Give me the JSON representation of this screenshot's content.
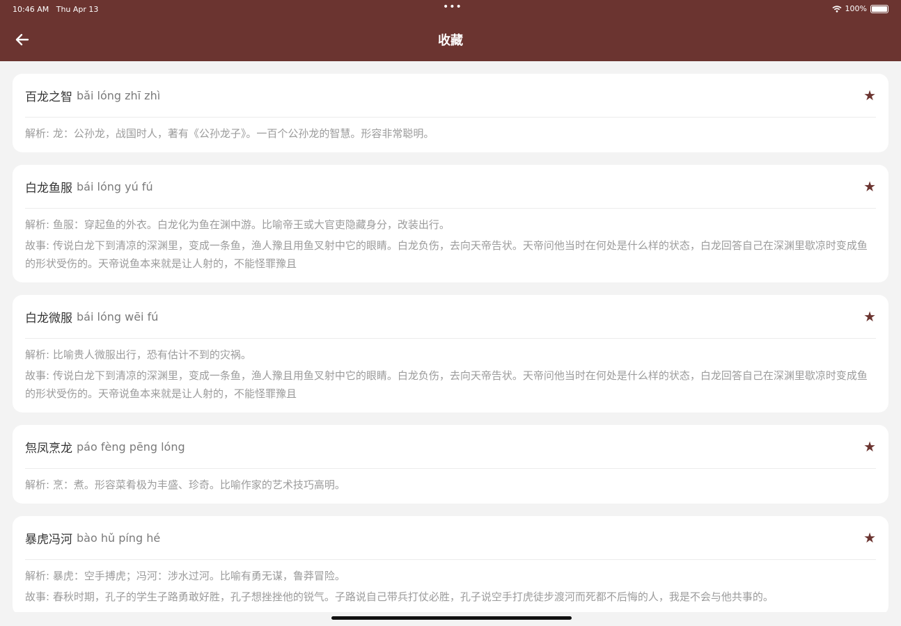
{
  "status": {
    "time": "10:46 AM",
    "date": "Thu Apr 13",
    "battery": "100%"
  },
  "header": {
    "title": "收藏"
  },
  "items": [
    {
      "word": "百龙之智",
      "pinyin": "bǎi lóng zhī zhì",
      "analysis": "解析: 龙：公孙龙，战国时人，著有《公孙龙子》。一百个公孙龙的智慧。形容非常聪明。",
      "story": ""
    },
    {
      "word": "白龙鱼服",
      "pinyin": "bái lóng yú fú",
      "analysis": "解析: 鱼服：穿起鱼的外衣。白龙化为鱼在渊中游。比喻帝王或大官吏隐藏身分，改装出行。",
      "story": "故事: 传说白龙下到清凉的深渊里，变成一条鱼，渔人豫且用鱼叉射中它的眼睛。白龙负伤，去向天帝告状。天帝问他当时在何处是什么样的状态，白龙回答自己在深渊里歇凉时变成鱼的形状受伤的。天帝说鱼本来就是让人射的，不能怪罪豫且"
    },
    {
      "word": "白龙微服",
      "pinyin": "bái lóng wēi fú",
      "analysis": "解析: 比喻贵人微服出行，恐有估计不到的灾祸。",
      "story": "故事: 传说白龙下到清凉的深渊里，变成一条鱼，渔人豫且用鱼叉射中它的眼睛。白龙负伤，去向天帝告状。天帝问他当时在何处是什么样的状态，白龙回答自己在深渊里歇凉时变成鱼的形状受伤的。天帝说鱼本来就是让人射的，不能怪罪豫且"
    },
    {
      "word": "炰凤烹龙",
      "pinyin": "páo fèng pēng lóng",
      "analysis": "解析: 烹：煮。形容菜肴极为丰盛、珍奇。比喻作家的艺术技巧高明。",
      "story": ""
    },
    {
      "word": "暴虎冯河",
      "pinyin": "bào hǔ píng hé",
      "analysis": "解析: 暴虎：空手搏虎；冯河：涉水过河。比喻有勇无谋，鲁莽冒险。",
      "story": "故事: 春秋时期，孔子的学生子路勇敢好胜，孔子想挫挫他的锐气。子路说自己带兵打仗必胜，孔子说空手打虎徒步渡河而死都不后悔的人，我是不会与他共事的。"
    }
  ],
  "colors": {
    "brand": "#6b3430",
    "background": "#f3f3f3"
  }
}
